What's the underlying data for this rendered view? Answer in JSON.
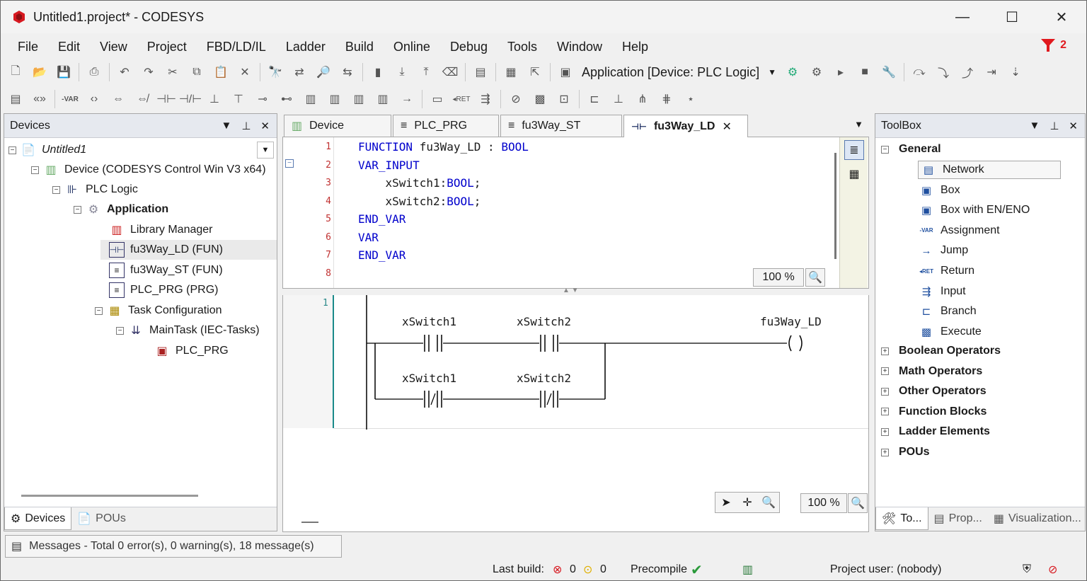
{
  "window": {
    "title": "Untitled1.project* - CODESYS",
    "controls": {
      "minimize": "—",
      "maximize": "☐",
      "close": "✕"
    }
  },
  "menu": [
    "File",
    "Edit",
    "View",
    "Project",
    "FBD/LD/IL",
    "Ladder",
    "Build",
    "Online",
    "Debug",
    "Tools",
    "Window",
    "Help"
  ],
  "alert_count": "2",
  "toolbar": {
    "application_selector": "Application [Device: PLC Logic]"
  },
  "devices_panel": {
    "title": "Devices",
    "tree": [
      {
        "label": "Untitled1",
        "italic": true
      },
      {
        "label": "Device (CODESYS Control Win V3 x64)"
      },
      {
        "label": "PLC Logic"
      },
      {
        "label": "Application",
        "bold": true
      },
      {
        "label": "Library Manager"
      },
      {
        "label": "fu3Way_LD (FUN)",
        "selected": true
      },
      {
        "label": "fu3Way_ST (FUN)"
      },
      {
        "label": "PLC_PRG (PRG)"
      },
      {
        "label": "Task Configuration"
      },
      {
        "label": "MainTask (IEC-Tasks)"
      },
      {
        "label": "PLC_PRG"
      }
    ],
    "bottom_tabs": [
      "Devices",
      "POUs"
    ]
  },
  "editor": {
    "tabs": [
      "Device",
      "PLC_PRG",
      "fu3Way_ST",
      "fu3Way_LD"
    ],
    "active_tab": "fu3Way_LD",
    "declaration_lines": [
      {
        "num": "1",
        "parts": [
          {
            "t": "FUNCTION ",
            "k": true
          },
          {
            "t": "fu3Way_LD",
            "k": false
          },
          {
            "t": " : ",
            "k": false
          },
          {
            "t": "BOOL",
            "k": true
          }
        ]
      },
      {
        "num": "2",
        "parts": [
          {
            "t": "VAR_INPUT",
            "k": true
          }
        ]
      },
      {
        "num": "3",
        "parts": [
          {
            "t": "    xSwitch1:",
            "k": false
          },
          {
            "t": "BOOL",
            "k": true
          },
          {
            "t": ";",
            "k": false
          }
        ]
      },
      {
        "num": "4",
        "parts": [
          {
            "t": "    xSwitch2:",
            "k": false
          },
          {
            "t": "BOOL",
            "k": true
          },
          {
            "t": ";",
            "k": false
          }
        ]
      },
      {
        "num": "5",
        "parts": [
          {
            "t": "END_VAR",
            "k": true
          }
        ]
      },
      {
        "num": "6",
        "parts": [
          {
            "t": "VAR",
            "k": true
          }
        ]
      },
      {
        "num": "7",
        "parts": [
          {
            "t": "END_VAR",
            "k": true
          }
        ]
      },
      {
        "num": "8",
        "parts": []
      }
    ],
    "decl_zoom": "100 %",
    "ladder": {
      "network_number": "1",
      "contacts_row1": [
        "xSwitch1",
        "xSwitch2"
      ],
      "contacts_row2": [
        "xSwitch1",
        "xSwitch2"
      ],
      "coil": "fu3Way_LD"
    },
    "ladder_zoom": "100 %"
  },
  "toolbox": {
    "title": "ToolBox",
    "general_header": "General",
    "general_items": [
      "Network",
      "Box",
      "Box with EN/ENO",
      "Assignment",
      "Jump",
      "Return",
      "Input",
      "Branch",
      "Execute"
    ],
    "groups": [
      "Boolean Operators",
      "Math Operators",
      "Other Operators",
      "Function Blocks",
      "Ladder Elements",
      "POUs"
    ],
    "bottom_tabs": [
      "To...",
      "Prop...",
      "Visualization..."
    ]
  },
  "messages": "Messages - Total 0 error(s), 0 warning(s), 18 message(s)",
  "status": {
    "last_build_label": "Last build:",
    "errors": "0",
    "warnings": "0",
    "precompile": "Precompile",
    "project_user": "Project user: (nobody)"
  }
}
